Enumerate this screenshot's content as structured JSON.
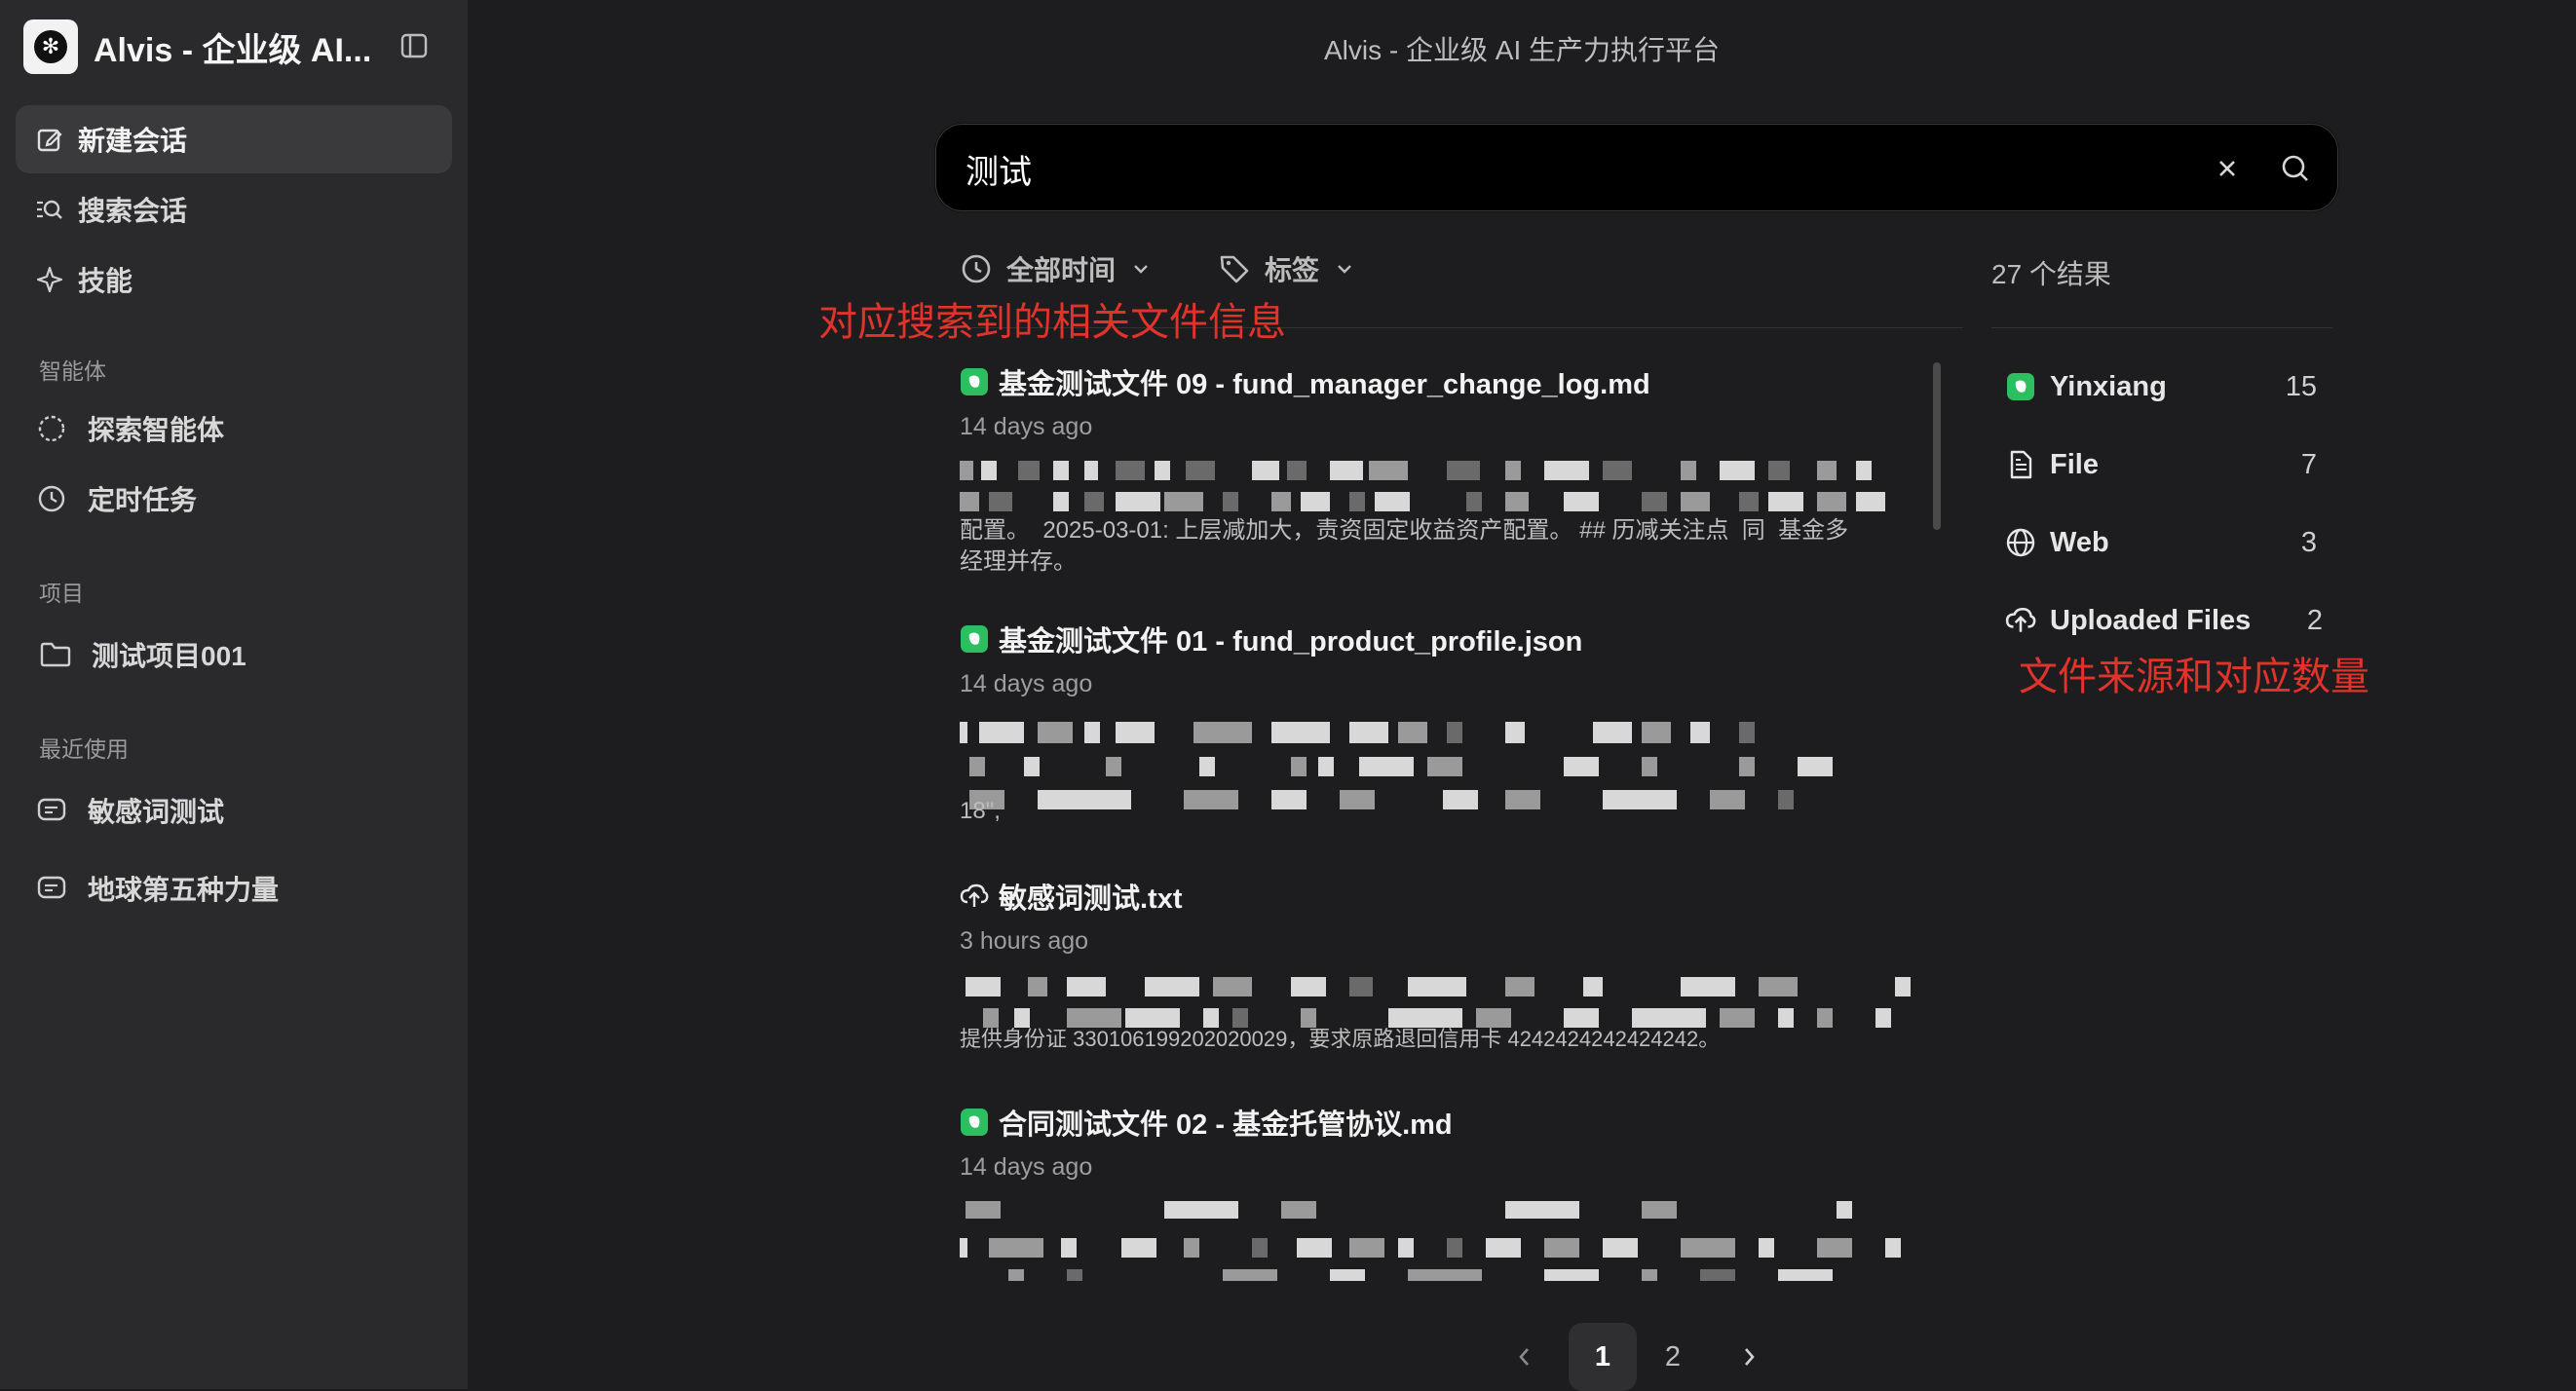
{
  "app": {
    "brand_title": "Alvis - 企业级 AI...",
    "window_title": "Alvis - 企业级 AI 生产力执行平台"
  },
  "sidebar": {
    "nav": [
      {
        "label": "新建会话",
        "icon": "edit-icon"
      },
      {
        "label": "搜索会话",
        "icon": "search-list-icon"
      },
      {
        "label": "技能",
        "icon": "sparkle-icon"
      }
    ],
    "sections": [
      {
        "label": "智能体",
        "items": [
          {
            "label": "探索智能体",
            "icon": "loader-circle-icon"
          },
          {
            "label": "定时任务",
            "icon": "clock-icon"
          }
        ]
      },
      {
        "label": "项目",
        "items": [
          {
            "label": "测试项目001",
            "icon": "folder-icon"
          }
        ]
      },
      {
        "label": "最近使用",
        "items": [
          {
            "label": "敏感词测试",
            "icon": "chat-icon"
          },
          {
            "label": "地球第五种力量",
            "icon": "chat-icon"
          }
        ]
      }
    ]
  },
  "search": {
    "query": "测试",
    "placeholder": ""
  },
  "filters": {
    "time_label": "全部时间",
    "tag_label": "标签"
  },
  "result_count": "27 个结果",
  "annotations": {
    "results_note": "对应搜索到的相关文件信息",
    "sources_note": "文件来源和对应数量"
  },
  "results": [
    {
      "title": "基金测试文件 09 - fund_manager_change_log.md",
      "source_icon": "evernote-icon",
      "time": "14 days ago",
      "snippet_visible": "配置。  2025-03-01: 上层减加大，责资固定收益资产配置。 ## 历减关注点  同  基金多\n经理并存。"
    },
    {
      "title": "基金测试文件 01 - fund_product_profile.json",
      "source_icon": "evernote-icon",
      "time": "14 days ago",
      "snippet_visible": "18\","
    },
    {
      "title": "敏感词测试.txt",
      "source_icon": "upload-cloud-icon",
      "time": "3 hours ago",
      "snippet_visible": "提供身份证 330106199202020029，要求原路退回信用卡 4242424242424242。"
    },
    {
      "title": "合同测试文件 02 - 基金托管协议.md",
      "source_icon": "evernote-icon",
      "time": "14 days ago",
      "snippet_visible": ""
    }
  ],
  "sources": [
    {
      "name": "Yinxiang",
      "count": "15",
      "icon": "evernote-icon"
    },
    {
      "name": "File",
      "count": "7",
      "icon": "file-text-icon"
    },
    {
      "name": "Web",
      "count": "3",
      "icon": "globe-icon"
    },
    {
      "name": "Uploaded Files",
      "count": "2",
      "icon": "upload-cloud-icon"
    }
  ],
  "pagination": {
    "pages": [
      "1",
      "2"
    ],
    "current": "1"
  },
  "colors": {
    "background": "#1d1d1f",
    "sidebar": "#2a2a2c",
    "accent_annotation": "#e0332b",
    "evernote_green": "#2dbe60"
  }
}
